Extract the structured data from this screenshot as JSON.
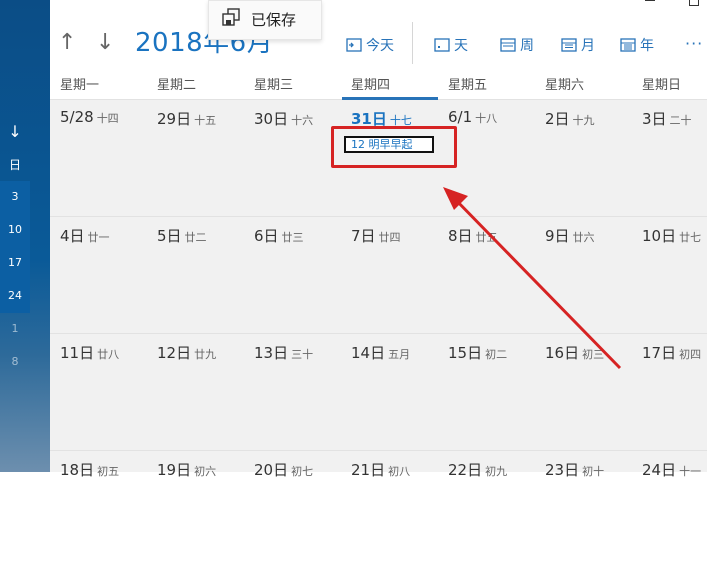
{
  "toolbar": {
    "month_title": "2018年6月",
    "saved_text": "已保存",
    "views": [
      {
        "label": "今天",
        "icon": "today-icon"
      },
      {
        "label": "天",
        "icon": "day-view-icon"
      },
      {
        "label": "周",
        "icon": "week-view-icon"
      },
      {
        "label": "月",
        "icon": "month-view-icon"
      },
      {
        "label": "年",
        "icon": "year-view-icon"
      }
    ],
    "more_label": "···"
  },
  "weekdays": [
    "星期一",
    "星期二",
    "星期三",
    "星期四",
    "星期五",
    "星期六",
    "星期日"
  ],
  "weeks": [
    {
      "days": [
        {
          "date": "5/28",
          "lunar": "十四"
        },
        {
          "date": "29日",
          "lunar": "十五"
        },
        {
          "date": "30日",
          "lunar": "十六"
        },
        {
          "date": "31日",
          "lunar": "十七"
        },
        {
          "date": "6/1",
          "lunar": "十八"
        },
        {
          "date": "2日",
          "lunar": "十九"
        },
        {
          "date": "3日",
          "lunar": "二十"
        }
      ]
    },
    {
      "days": [
        {
          "date": "4日",
          "lunar": "廿一"
        },
        {
          "date": "5日",
          "lunar": "廿二"
        },
        {
          "date": "6日",
          "lunar": "廿三"
        },
        {
          "date": "7日",
          "lunar": "廿四"
        },
        {
          "date": "8日",
          "lunar": "廿五"
        },
        {
          "date": "9日",
          "lunar": "廿六"
        },
        {
          "date": "10日",
          "lunar": "廿七"
        }
      ]
    },
    {
      "days": [
        {
          "date": "11日",
          "lunar": "廿八"
        },
        {
          "date": "12日",
          "lunar": "廿九"
        },
        {
          "date": "13日",
          "lunar": "三十"
        },
        {
          "date": "14日",
          "lunar": "五月"
        },
        {
          "date": "15日",
          "lunar": "初二"
        },
        {
          "date": "16日",
          "lunar": "初三"
        },
        {
          "date": "17日",
          "lunar": "初四"
        }
      ]
    },
    {
      "days": [
        {
          "date": "18日",
          "lunar": "初五"
        },
        {
          "date": "19日",
          "lunar": "初六"
        },
        {
          "date": "20日",
          "lunar": "初七"
        },
        {
          "date": "21日",
          "lunar": "初八"
        },
        {
          "date": "22日",
          "lunar": "初九"
        },
        {
          "date": "23日",
          "lunar": "初十"
        },
        {
          "date": "24日",
          "lunar": "十一"
        }
      ]
    }
  ],
  "event": {
    "time": "12",
    "title": "明早早起"
  },
  "sidebar": {
    "selected_label": "日",
    "week_numbers": [
      "3",
      "10",
      "17",
      "24"
    ],
    "dim_numbers": [
      "1",
      "8"
    ]
  },
  "colors": {
    "accent": "#1a73c0",
    "highlight_red": "#d62323",
    "sidebar_blue": "#0b4d86",
    "grid_bg": "#f1f1f1"
  }
}
